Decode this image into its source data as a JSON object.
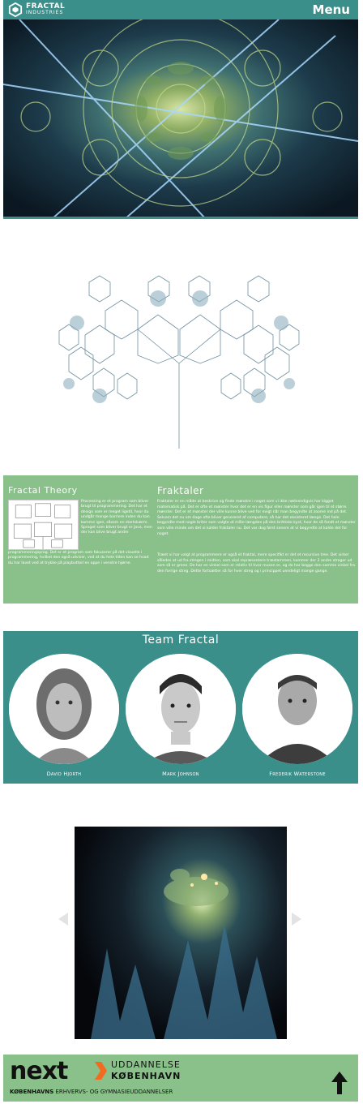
{
  "header": {
    "logo_line1": "FRACTAL",
    "logo_line2": "INDUSTRIES",
    "menu_label": "Menu",
    "accent_color": "#3a8f8b"
  },
  "hero": {
    "image": "kaleidoscope-fractal-image"
  },
  "tree": {
    "image": "pythagoras-tree-fractal-image"
  },
  "theory": {
    "heading_left": "Fractal Theory",
    "heading_right": "Fraktaler",
    "left_wrap_text": "Processing er et program som bliver brugt til programmering. Det har et design som er meget ligetil, hvor du undgår mange barriere inden du kan komme igen, såsom en startskærm. Sproget som bliver brugt er Java, men der kan blive brugt andre",
    "left_bottom_text": "programmeringsprog. Det er et program som fokuserer på det visuelle i programmering, hvilket den også udviser, ved at du hele tiden kan se hvad du har lavet ved at trykke på playbutton'en oppe i venstre hjørne.",
    "right_p1": "Fraktaler er en måde at beskrive og finde mønstre i noget som vi ikke nødvendigvis har kigget matematisk på. Det er ofte et mønster hvor det er en vis figur eller mønster som går igen til et større mønster. Det er et mønster der ville kunne blive ved for evigt når man begyndte at zoome ind på det. Selvom det nu om dage ofte bliver genereret af computere, så har det eksisteret længe. Det hele begyndte med nogle briter som valgte at måle længden på den brittiske kyst, hvor de så fandt et mønster som ville minde om det vi kalder fraktaler nu. Det var dog først senere at vi begyndte at kalde det for noget.",
    "right_p2": "Træet vi har valgt at programmere er også et fraktal, mere specifikt er det et recursive tree. Det virker således at ud fra stregen i midten, som skal repræsentere træstammen, kommer der 2 andre streger ud som så er grene. De har en vinkel som er relativ til hvor musen er, og de har begge den samme vinkel fra den forrige streg. Dette fortsætter så for hver streg og i princippet uendeligt mange gange."
  },
  "team": {
    "title": "Team Fractal",
    "members": [
      {
        "name": "David Hjorth"
      },
      {
        "name": "Mark Johnson"
      },
      {
        "name": "Frederik Waterstone"
      }
    ]
  },
  "gallery": {
    "image": "fern-fractal-image",
    "prev_icon": "chevron-left-icon",
    "next_icon": "chevron-right-icon"
  },
  "footer": {
    "brand_word": "next",
    "line1": "UDDANNELSE",
    "line2": "KØBENHAVN",
    "sub_bold": "KØBENHAVNS",
    "sub_rest": " ERHVERVS- OG GYMNASIEUDDANNELSER",
    "brand_accent": "#f26b21",
    "back_to_top_icon": "arrow-up-icon"
  }
}
